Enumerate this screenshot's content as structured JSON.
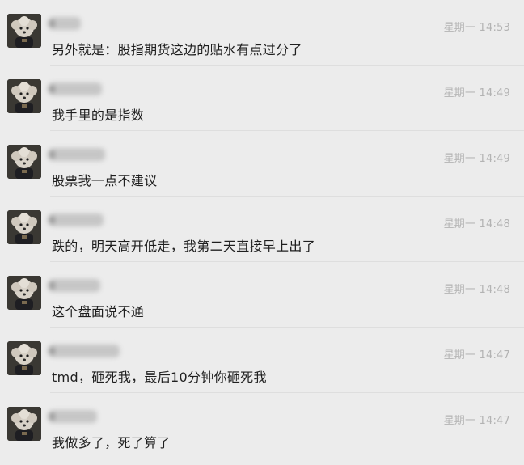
{
  "messages": [
    {
      "text": "另外就是：股指期货这边的贴水有点过分了",
      "time": "星期一 14:53"
    },
    {
      "text": "我手里的是指数",
      "time": "星期一 14:49"
    },
    {
      "text": "股票我一点不建议",
      "time": "星期一 14:49"
    },
    {
      "text": "跌的，明天高开低走，我第二天直接早上出了",
      "time": "星期一 14:48"
    },
    {
      "text": "这个盘面说不通",
      "time": "星期一 14:48"
    },
    {
      "text": "tmd，砸死我，最后10分钟你砸死我",
      "time": "星期一 14:47"
    },
    {
      "text": "我做多了，死了算了",
      "time": "星期一 14:47"
    }
  ]
}
